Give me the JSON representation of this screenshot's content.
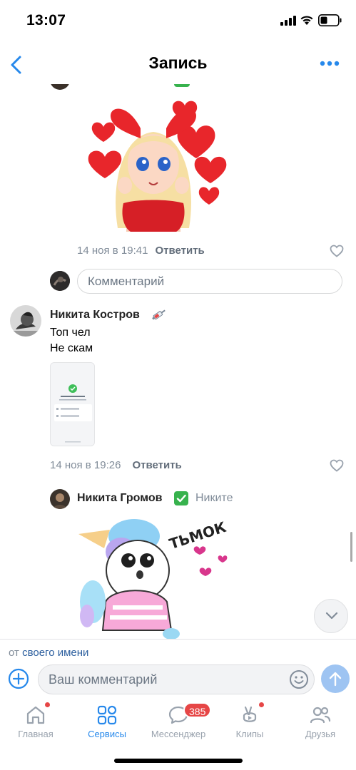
{
  "status_bar": {
    "time": "13:07"
  },
  "nav": {
    "title": "Запись"
  },
  "comments": [
    {
      "time": "14 ноя в 19:41",
      "reply": "Ответить"
    },
    {
      "author": "Никита Костров",
      "lines": [
        "Топ чел",
        "Не скам"
      ],
      "time": "14 ноя в 19:26",
      "reply": "Ответить"
    },
    {
      "author": "Никита Громов",
      "reply_to": "Никите"
    }
  ],
  "inline_comment": {
    "placeholder": "Комментарий"
  },
  "compose": {
    "from_prefix": "от",
    "from_link": "своего имени",
    "placeholder": "Ваш комментарий"
  },
  "tabs": [
    {
      "label": "Главная",
      "icon": "home-icon"
    },
    {
      "label": "Сервисы",
      "icon": "services-icon",
      "active": true
    },
    {
      "label": "Мессенджер",
      "icon": "messenger-icon",
      "badge": "385"
    },
    {
      "label": "Клипы",
      "icon": "clips-icon"
    },
    {
      "label": "Друзья",
      "icon": "friends-icon"
    }
  ],
  "colors": {
    "accent": "#2688eb",
    "link": "#2b5e9e",
    "meta": "#818c99",
    "badge": "#e64646",
    "verified": "#37b24d"
  }
}
